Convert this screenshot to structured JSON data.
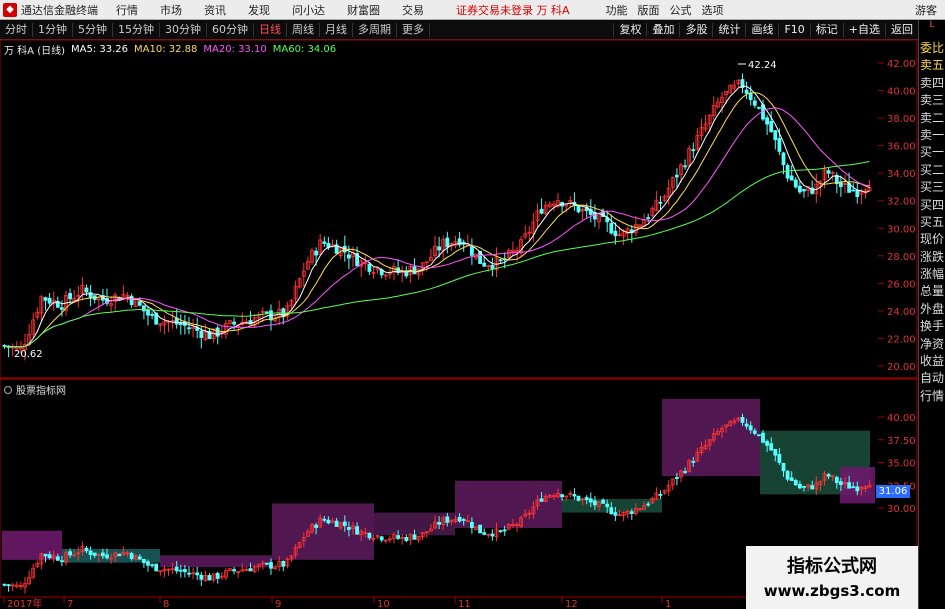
{
  "menubar": {
    "app_title": "通达信金融终端",
    "items": [
      "行情",
      "市场",
      "资讯",
      "发现",
      "问小达",
      "财富圈",
      "交易"
    ],
    "warning": "证券交易未登录 万 科A",
    "right_items": [
      "功能",
      "版面",
      "公式",
      "选项"
    ],
    "guest": "游客"
  },
  "toolbar": {
    "periods": [
      "分时",
      "1分钟",
      "5分钟",
      "15分钟",
      "30分钟",
      "60分钟",
      "日线",
      "周线",
      "月线",
      "多周期",
      "更多"
    ],
    "active_period": "日线",
    "right_tools": [
      "复权",
      "叠加",
      "多股",
      "统计",
      "画线",
      "F10",
      "标记",
      "+自选",
      "返回"
    ]
  },
  "stock": {
    "name": "万 科A (日线)",
    "ma5": "MA5: 33.26",
    "ma10": "MA10: 32.88",
    "ma20": "MA20: 33.10",
    "ma60": "MA60: 34.06"
  },
  "indicator": {
    "label": "股票指标网"
  },
  "sidepanel": {
    "top": "L",
    "items": [
      "委比",
      "卖五",
      "卖四",
      "卖三",
      "卖二",
      "卖一",
      "买一",
      "买二",
      "买三",
      "买四",
      "买五",
      "现价",
      "涨跌",
      "涨幅",
      "总量",
      "外盘",
      "换手",
      "净资",
      "收益",
      "自动",
      "行情"
    ]
  },
  "main_chart": {
    "y_labels": [
      "42.00",
      "40.00",
      "38.00",
      "36.00",
      "34.00",
      "32.00",
      "30.00",
      "28.00",
      "26.00",
      "24.00",
      "22.00",
      "20.00"
    ],
    "y_values": [
      42,
      40,
      38,
      36,
      34,
      32,
      30,
      28,
      26,
      24,
      22,
      20
    ],
    "high_label": "42.24",
    "low_label": "20.62",
    "colors": {
      "up": "#ff3232",
      "down": "#54ffff",
      "ma5": "#ffffff",
      "ma10": "#ffdd55",
      "ma20": "#ff55ff",
      "ma60": "#55ff55"
    }
  },
  "sub_chart": {
    "y_labels": [
      "40.00",
      "37.50",
      "35.00",
      "32.50",
      "30.00"
    ],
    "y_values": [
      40,
      37.5,
      35,
      32.5,
      30
    ],
    "current_price": "31.06"
  },
  "x_labels": [
    "2017年",
    "7",
    "8",
    "9",
    "10",
    "11",
    "12",
    "1"
  ],
  "watermark": {
    "line1": "指标公式网",
    "line2": "www.zbgs3.com"
  }
}
